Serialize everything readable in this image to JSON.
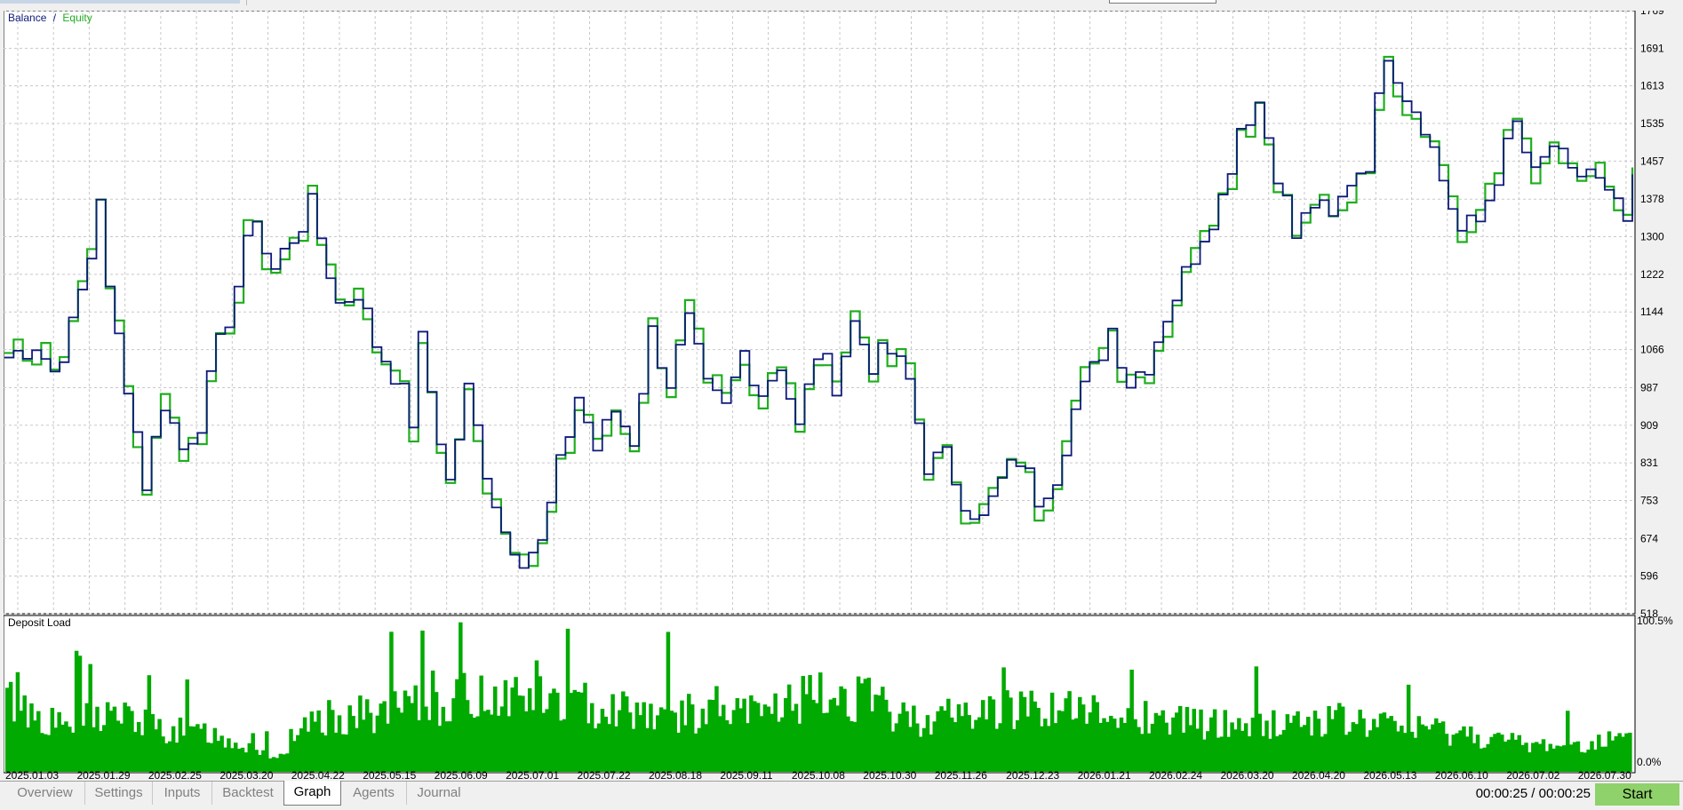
{
  "colors": {
    "balance": "#0d1a7a",
    "equity": "#1fae1f",
    "deposit_load": "#00aa00",
    "grid": "#c8c8c8",
    "active_tab_bg": "#ffffff",
    "start_button": "#8fd16a"
  },
  "tabs": [
    {
      "label": "Overview",
      "active": false
    },
    {
      "label": "Settings",
      "active": false
    },
    {
      "label": "Inputs",
      "active": false
    },
    {
      "label": "Backtest",
      "active": false
    },
    {
      "label": "Graph",
      "active": true
    },
    {
      "label": "Agents",
      "active": false
    },
    {
      "label": "Journal",
      "active": false
    }
  ],
  "status": {
    "timer": "00:00:25 / 00:00:25",
    "start_label": "Start"
  },
  "chart_data": [
    {
      "type": "line",
      "legend": {
        "balance_label": "Balance",
        "separator": "/",
        "equity_label": "Equity",
        "placement": "top-left"
      },
      "ylim": [
        518,
        1769
      ],
      "y_ticks": [
        1769,
        1691,
        1613,
        1535,
        1457,
        1378,
        1300,
        1222,
        1144,
        1066,
        987,
        909,
        831,
        753,
        674,
        596,
        518
      ],
      "grid": true,
      "x_labels": [
        "2025.01.03",
        "2025.01.29",
        "2025.02.25",
        "2025.03.20",
        "2025.04.22",
        "2025.05.15",
        "2025.06.09",
        "2025.07.01",
        "2025.07.22",
        "2025.08.18",
        "2025.09.11",
        "2025.10.08",
        "2025.10.30",
        "2025.11.26",
        "2025.12.23",
        "2026.01.21",
        "2026.02.24",
        "2026.03.20",
        "2026.04.20",
        "2026.05.13",
        "2026.06.10",
        "2026.07.02",
        "2026.07.30"
      ],
      "series": [
        {
          "name": "Balance",
          "key_points": [
            [
              0,
              1050
            ],
            [
              3,
              1080
            ],
            [
              5,
              1020
            ],
            [
              7,
              1110
            ],
            [
              9,
              1260
            ],
            [
              10,
              1390
            ],
            [
              11,
              1180
            ],
            [
              13,
              1000
            ],
            [
              15,
              790
            ],
            [
              17,
              960
            ],
            [
              19,
              860
            ],
            [
              21,
              920
            ],
            [
              23,
              1070
            ],
            [
              25,
              1200
            ],
            [
              27,
              1350
            ],
            [
              28,
              1270
            ],
            [
              29,
              1230
            ],
            [
              31,
              1300
            ],
            [
              33,
              1360
            ],
            [
              34,
              1300
            ],
            [
              36,
              1160
            ],
            [
              38,
              1190
            ],
            [
              40,
              1080
            ],
            [
              42,
              1020
            ],
            [
              43,
              970
            ],
            [
              44,
              920
            ],
            [
              45,
              1080
            ],
            [
              46,
              980
            ],
            [
              48,
              790
            ],
            [
              50,
              980
            ],
            [
              52,
              820
            ],
            [
              54,
              690
            ],
            [
              56,
              640
            ],
            [
              58,
              660
            ],
            [
              60,
              820
            ],
            [
              62,
              970
            ],
            [
              64,
              860
            ],
            [
              66,
              940
            ],
            [
              68,
              880
            ],
            [
              70,
              1100
            ],
            [
              72,
              1000
            ],
            [
              74,
              1120
            ],
            [
              76,
              980
            ],
            [
              78,
              940
            ],
            [
              80,
              1060
            ],
            [
              82,
              980
            ],
            [
              84,
              1040
            ],
            [
              86,
              900
            ],
            [
              88,
              1060
            ],
            [
              90,
              1000
            ],
            [
              92,
              1120
            ],
            [
              94,
              1040
            ],
            [
              96,
              1060
            ],
            [
              98,
              1000
            ],
            [
              100,
              830
            ],
            [
              102,
              840
            ],
            [
              104,
              760
            ],
            [
              106,
              710
            ],
            [
              108,
              790
            ],
            [
              110,
              840
            ],
            [
              112,
              760
            ],
            [
              114,
              810
            ],
            [
              116,
              940
            ],
            [
              118,
              1020
            ],
            [
              120,
              1110
            ],
            [
              122,
              1000
            ],
            [
              124,
              1040
            ],
            [
              126,
              1140
            ],
            [
              128,
              1220
            ],
            [
              130,
              1310
            ],
            [
              132,
              1380
            ],
            [
              134,
              1530
            ],
            [
              136,
              1580
            ],
            [
              138,
              1440
            ],
            [
              140,
              1300
            ],
            [
              142,
              1370
            ],
            [
              144,
              1330
            ],
            [
              146,
              1420
            ],
            [
              148,
              1460
            ],
            [
              150,
              1690
            ],
            [
              152,
              1600
            ],
            [
              154,
              1540
            ],
            [
              156,
              1420
            ],
            [
              158,
              1310
            ],
            [
              160,
              1330
            ],
            [
              162,
              1430
            ],
            [
              164,
              1530
            ],
            [
              166,
              1420
            ],
            [
              168,
              1490
            ],
            [
              170,
              1420
            ],
            [
              172,
              1440
            ],
            [
              174,
              1380
            ],
            [
              176,
              1330
            ],
            [
              177,
              1400
            ]
          ],
          "n_points": 178
        },
        {
          "name": "Equity",
          "note_values": "Equity closely follows Balance with spikes of roughly ±30"
        }
      ]
    },
    {
      "type": "bar",
      "legend": {
        "label": "Deposit Load",
        "placement": "top-left"
      },
      "ylim": [
        0,
        100.5
      ],
      "y_ticks": [
        "100.5%",
        "0.0%"
      ],
      "n_bars": 470,
      "profile": [
        [
          0,
          55
        ],
        [
          15,
          35
        ],
        [
          30,
          45
        ],
        [
          45,
          32
        ],
        [
          60,
          28
        ],
        [
          70,
          20
        ],
        [
          80,
          10
        ],
        [
          90,
          40
        ],
        [
          110,
          45
        ],
        [
          130,
          55
        ],
        [
          145,
          60
        ],
        [
          160,
          52
        ],
        [
          175,
          50
        ],
        [
          190,
          45
        ],
        [
          210,
          42
        ],
        [
          230,
          55
        ],
        [
          245,
          58
        ],
        [
          260,
          40
        ],
        [
          280,
          45
        ],
        [
          300,
          50
        ],
        [
          320,
          42
        ],
        [
          340,
          38
        ],
        [
          360,
          35
        ],
        [
          380,
          40
        ],
        [
          400,
          35
        ],
        [
          420,
          30
        ],
        [
          440,
          20
        ],
        [
          455,
          22
        ],
        [
          469,
          25
        ]
      ]
    }
  ]
}
